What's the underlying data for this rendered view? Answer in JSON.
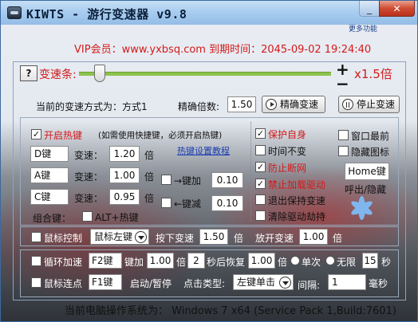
{
  "window": {
    "title": "KIWTS - 游行变速器 v9.8",
    "minimize_glyph": "_",
    "close_glyph": "✕",
    "more_features": "更多功能"
  },
  "vip": {
    "text": "VIP会员：www.yxbsq.com 到期时间：2045-09-02 19:24:40"
  },
  "speed_bar": {
    "help": "?",
    "label": "变速条:",
    "plus": "+",
    "minus": "−",
    "multiplier": "x1.5倍",
    "level_fraction": 0.08
  },
  "mode": {
    "label": "当前的变速方式为：方式1",
    "precision_label": "精确倍数:",
    "precision_value": "1.50",
    "precise_button": "精确变速",
    "stop_button": "停止变速"
  },
  "hotkeys": {
    "enable_label": "开启热键",
    "enable_checked": true,
    "hint": "(如需使用快捷键，必须开启热键)",
    "tutorial_link": "热键设置教程",
    "rows": [
      {
        "key": "D键",
        "speed_label": "变速：",
        "value": "1.20",
        "unit": "倍"
      },
      {
        "key": "A键",
        "speed_label": "变速：",
        "value": "1.00",
        "unit": "倍"
      },
      {
        "key": "C键",
        "speed_label": "变速：",
        "value": "0.95",
        "unit": "倍"
      }
    ],
    "plus_label": "→键加",
    "plus_value": "0.10",
    "minus_label": "←键减",
    "minus_value": "0.10",
    "combo_label": "组合键：",
    "alt_label": "ALT+热键"
  },
  "protection": {
    "items": [
      {
        "label": "保护自身",
        "checked": true,
        "red": true
      },
      {
        "label": "时间不变",
        "checked": false,
        "red": false
      },
      {
        "label": "防止断网",
        "checked": true,
        "red": true
      },
      {
        "label": "禁止加载驱动",
        "checked": true,
        "red": true
      },
      {
        "label": "退出保持变速",
        "checked": false,
        "red": false
      },
      {
        "label": "清除驱动劫持",
        "checked": false,
        "red": false
      }
    ],
    "topmost": "窗口最前",
    "hide_icon": "隐藏图标",
    "home_key": "Home键",
    "home_hint": "呼出/隐藏"
  },
  "mouse_control": {
    "label": "鼠标控制",
    "button": "鼠标左键",
    "press_label": "按下变速",
    "press_value": "1.50",
    "unit": "倍",
    "release_label": "放开变速",
    "release_value": "1.00"
  },
  "loop_speed": {
    "label": "循环加速",
    "key": "F2键",
    "add_label": "键加",
    "add_value": "1.00",
    "unit": "倍",
    "seconds": "2",
    "restore_label": "秒后恢复",
    "restore_value": "1.00",
    "once_label": "单次",
    "infinite_label": "无限",
    "count": "15",
    "sec_unit": "秒"
  },
  "mouse_click": {
    "label": "鼠标连点",
    "key": "F1键",
    "toggle_label": "启动/暂停",
    "type_label": "点击类型:",
    "type_value": "左键单击",
    "interval_label": "间隔:",
    "interval_value": "1",
    "ms_unit": "毫秒"
  },
  "footer": {
    "text": "当前电脑操作系统为： Windows 7 x64 (Service Pack 1,Build:7601)"
  },
  "icons": {
    "app": "speedometer-icon",
    "play": "play-icon",
    "pause": "pause-icon",
    "asterisk": "asterisk-icon"
  }
}
